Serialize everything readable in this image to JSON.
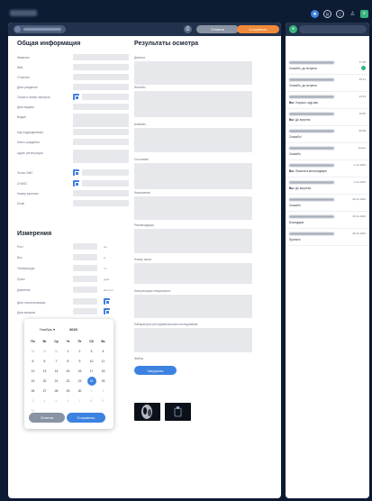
{
  "colors": {
    "bg": "#0c1a33",
    "accent": "#3d82e0",
    "save": "#f08a3a",
    "cancel": "#8993a3",
    "online": "#36b37e"
  },
  "header": {
    "cancel_label": "Отмена",
    "save_label": "Сохранить"
  },
  "general": {
    "title": "Общая информация",
    "fields": [
      "Фамилия",
      "Имя",
      "Отчество",
      "Дата рождения",
      "Серия и номер паспорта",
      "Дата выдачи",
      "Выдан",
      "Код подразделения",
      "Место рождения",
      "Адрес регистрации",
      "Полис ОМС",
      "СНИЛС",
      "Номер карточки",
      "Email"
    ]
  },
  "measures": {
    "title": "Измерения",
    "fields": [
      {
        "label": "Рост",
        "unit": "см"
      },
      {
        "label": "Вес",
        "unit": "кг"
      },
      {
        "label": "Температура",
        "unit": "°C"
      },
      {
        "label": "Пульс",
        "unit": "уд/м"
      },
      {
        "label": "Давление",
        "unit": "мм рт.ст."
      }
    ],
    "hosp_label": "Дата госпитализации",
    "discharge_label": "Дата выписки"
  },
  "exam": {
    "title": "Результаты осмотра",
    "fields": [
      "Диагноз",
      "Жалобы",
      "Анамнез",
      "Состояние",
      "Назначения",
      "Рекомендации",
      "Номер палат",
      "Консультации специалиста",
      "Лабораторно-инструментальные исследования"
    ],
    "files_label": "Файлы",
    "upload_label": "Загрузить"
  },
  "calendar": {
    "month": "Ноябрь",
    "year": "2023",
    "weekdays": [
      "Пн",
      "Вт",
      "Ср",
      "Чт",
      "Пт",
      "Сб",
      "Вс"
    ],
    "days": [
      "30",
      "31",
      "31",
      "1",
      "2",
      "3",
      "4",
      "5",
      "6",
      "7",
      "8",
      "9",
      "10",
      "11",
      "12",
      "13",
      "14",
      "15",
      "16",
      "17",
      "18",
      "19",
      "20",
      "21",
      "22",
      "23",
      "24",
      "25",
      "26",
      "27",
      "28",
      "29",
      "30",
      "1",
      "2",
      "3",
      "4",
      "5",
      "6",
      "7",
      "8",
      "9",
      "10"
    ],
    "muted": [
      0,
      1,
      2,
      33,
      34,
      35,
      36,
      37,
      38,
      39,
      40,
      41,
      42
    ],
    "selected": 26,
    "highlighted": 4,
    "cancel_label": "Отмена",
    "save_label": "Сохранить"
  },
  "messages": [
    {
      "time": "17:08",
      "text": "Спасибо, до встречи",
      "you": false,
      "unread": true
    },
    {
      "time": "15:41",
      "text": "Спасибо, до встречи",
      "you": false,
      "unread": false
    },
    {
      "time": "13:34",
      "text": "Хорошо, жду вас",
      "you": true,
      "unread": false
    },
    {
      "time": "10:56",
      "text": "До встречи",
      "you": true,
      "unread": false
    },
    {
      "time": "09:38",
      "text": "Спасибо!",
      "you": false,
      "unread": false
    },
    {
      "time": "вчера",
      "text": "Спасибо",
      "you": false,
      "unread": false
    },
    {
      "time": "2.12.2023",
      "text": "Пишите в мессенджере",
      "you": true,
      "unread": false
    },
    {
      "time": "1.12.2023",
      "text": "До встречи!",
      "you": true,
      "unread": false
    },
    {
      "time": "29.11.2023",
      "text": "Спасибо",
      "you": false,
      "unread": false
    },
    {
      "time": "29.11.2023",
      "text": "Благодарю",
      "you": false,
      "unread": false
    },
    {
      "time": "28.11.2023",
      "text": "Принято",
      "you": false,
      "unread": false
    }
  ],
  "you_prefix": "Вы:"
}
